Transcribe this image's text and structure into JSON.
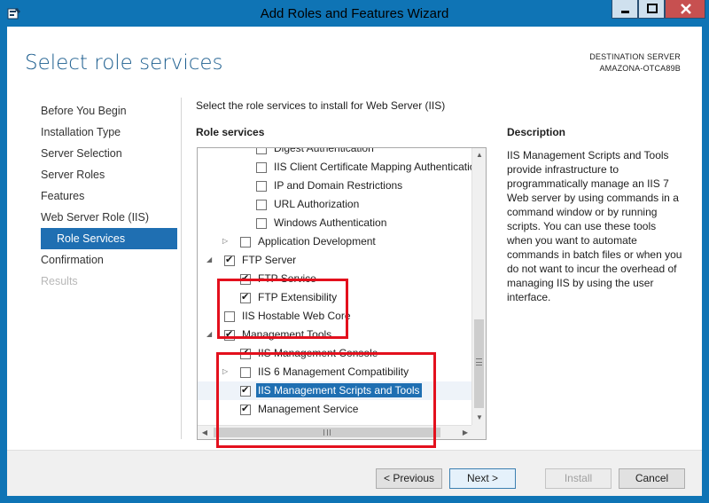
{
  "window": {
    "title": "Add Roles and Features Wizard"
  },
  "header": {
    "page_title": "Select role services",
    "destination_label": "DESTINATION SERVER",
    "destination_server": "AMAZONA-OTCA89B"
  },
  "nav": [
    {
      "label": "Before You Begin",
      "state": "normal"
    },
    {
      "label": "Installation Type",
      "state": "normal"
    },
    {
      "label": "Server Selection",
      "state": "normal"
    },
    {
      "label": "Server Roles",
      "state": "normal"
    },
    {
      "label": "Features",
      "state": "normal"
    },
    {
      "label": "Web Server Role (IIS)",
      "state": "normal"
    },
    {
      "label": "Role Services",
      "state": "active"
    },
    {
      "label": "Confirmation",
      "state": "normal"
    },
    {
      "label": "Results",
      "state": "disabled"
    }
  ],
  "main": {
    "instruction": "Select the role services to install for Web Server (IIS)",
    "role_services_heading": "Role services",
    "tree": [
      {
        "label": "Digest Authentication",
        "checked": false,
        "expander": ""
      },
      {
        "label": "IIS Client Certificate Mapping Authentication",
        "checked": false,
        "expander": ""
      },
      {
        "label": "IP and Domain Restrictions",
        "checked": false,
        "expander": ""
      },
      {
        "label": "URL Authorization",
        "checked": false,
        "expander": ""
      },
      {
        "label": "Windows Authentication",
        "checked": false,
        "expander": ""
      },
      {
        "label": "Application Development",
        "checked": false,
        "expander": "collapsed"
      },
      {
        "label": "FTP Server",
        "checked": true,
        "expander": "expanded"
      },
      {
        "label": "FTP Service",
        "checked": true,
        "expander": ""
      },
      {
        "label": "FTP Extensibility",
        "checked": true,
        "expander": ""
      },
      {
        "label": "IIS Hostable Web Core",
        "checked": false,
        "expander": ""
      },
      {
        "label": "Management Tools",
        "checked": true,
        "expander": "expanded"
      },
      {
        "label": "IIS Management Console",
        "checked": true,
        "expander": ""
      },
      {
        "label": "IIS 6 Management Compatibility",
        "checked": false,
        "expander": "collapsed"
      },
      {
        "label": "IIS Management Scripts and Tools",
        "checked": true,
        "expander": "",
        "selected": true
      },
      {
        "label": "Management Service",
        "checked": true,
        "expander": ""
      }
    ]
  },
  "description": {
    "heading": "Description",
    "text": "IIS Management Scripts and Tools provide infrastructure to programmatically manage an IIS 7 Web server by using commands in a command window or by running scripts. You can use these tools when you want to automate commands in batch files or when you do not want to incur the overhead of managing IIS by using the user interface."
  },
  "buttons": {
    "previous": "< Previous",
    "next": "Next >",
    "install": "Install",
    "cancel": "Cancel"
  },
  "icons": {
    "app": "wizard-icon",
    "minimize": "minimize-icon",
    "maximize": "maximize-icon",
    "close": "close-icon"
  },
  "colors": {
    "accent": "#1f6fb2",
    "title_blue": "#1d5e8f",
    "highlight_border": "#e3101d",
    "frame": "#0f74b5"
  }
}
